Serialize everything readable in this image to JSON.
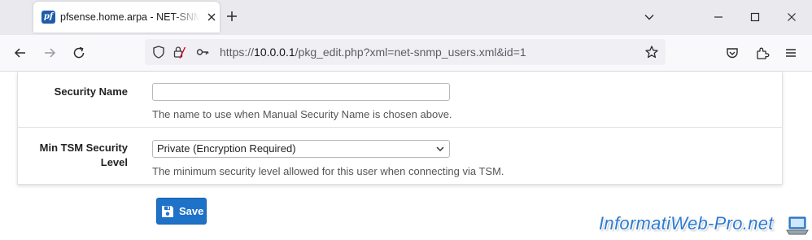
{
  "browser": {
    "tab_title": "pfsense.home.arpa - NET-SNMP",
    "favicon_text": "pf",
    "url_prefix": "https://",
    "url_host": "10.0.0.1",
    "url_path": "/pkg_edit.php?xml=net-snmp_users.xml&id=1"
  },
  "form": {
    "security_name": {
      "label": "Security Name",
      "value": "",
      "help": "The name to use when Manual Security Name is chosen above."
    },
    "min_tsm": {
      "label_line1": "Min TSM Security",
      "label_line2": "Level",
      "selected": "Private (Encryption Required)",
      "help": "The minimum security level allowed for this user when connecting via TSM."
    },
    "save_label": "Save"
  },
  "watermark": {
    "text": "InformatiWeb-Pro.net"
  },
  "colors": {
    "accent": "#1e72c8",
    "watermark": "#2d7bd1",
    "favicon": "#1e5ca8"
  }
}
